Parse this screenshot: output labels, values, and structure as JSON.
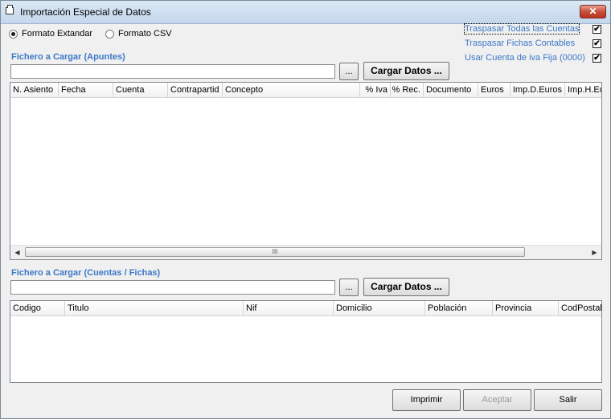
{
  "window": {
    "title": "Importación Especial de Datos",
    "close_label": "✕"
  },
  "format": {
    "option1": "Formato Extandar",
    "option2": "Formato CSV",
    "selected": "Formato Extandar"
  },
  "options": [
    {
      "label": "Traspasar Todas las Cuentas",
      "checked": true,
      "mark": "✔"
    },
    {
      "label": "Traspasar Fichas Contables",
      "checked": true,
      "mark": "✔"
    },
    {
      "label": "Usar Cuenta de iva Fija (0000)",
      "checked": true,
      "mark": "✔"
    }
  ],
  "apuntes": {
    "label": "Fichero a Cargar (Apuntes)",
    "file_value": "",
    "browse_label": "...",
    "load_label": "Cargar Datos ...",
    "columns": [
      "N. Asiento",
      "Fecha",
      "Cuenta",
      "Contrapartid",
      "Concepto",
      "% Iva",
      "% Rec.",
      "Documento",
      "Euros",
      "Imp.D.Euros",
      "Imp.H.Eu"
    ],
    "scroll_left": "◀",
    "scroll_right": "▶",
    "scroll_grip": "III"
  },
  "cuentas": {
    "label": "Fichero a Cargar (Cuentas / Fichas)",
    "file_value": "",
    "browse_label": "...",
    "load_label": "Cargar Datos ...",
    "columns": [
      "Codigo",
      "Titulo",
      "Nif",
      "Domicilio",
      "Población",
      "Provincia",
      "CodPostal"
    ]
  },
  "footer": {
    "print_label": "Imprimir",
    "accept_label": "Aceptar",
    "exit_label": "Salir",
    "accept_enabled": false
  }
}
